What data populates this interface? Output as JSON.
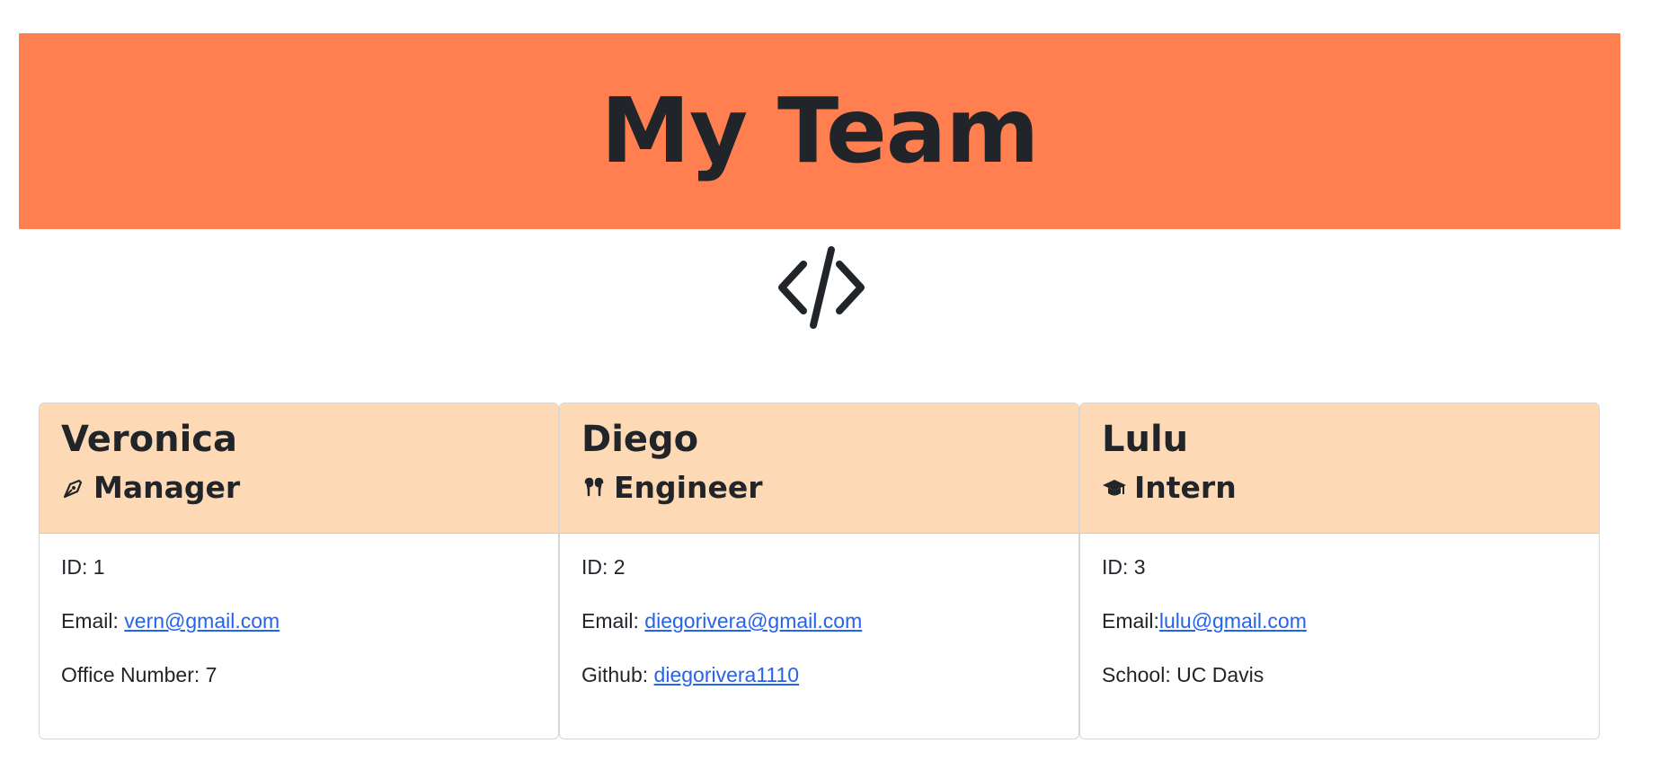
{
  "header": {
    "title": "My Team"
  },
  "icons": {
    "logo": "code-icon",
    "manager": "pen-nib-icon",
    "engineer": "earbuds-icon",
    "intern": "graduation-cap-icon"
  },
  "colors": {
    "banner": "#ff7f50",
    "card_header": "#fdd9b5",
    "link": "#2563eb"
  },
  "cards": [
    {
      "name": "Veronica",
      "role": "Manager",
      "id_label": "ID: 1",
      "email_label": "Email: ",
      "email": "vern@gmail.com",
      "extra_label": "Office Number: 7"
    },
    {
      "name": "Diego",
      "role": "Engineer",
      "id_label": "ID: 2",
      "email_label": "Email: ",
      "email": "diegorivera@gmail.com",
      "extra_label": "Github: ",
      "extra_link": "diegorivera1110"
    },
    {
      "name": "Lulu",
      "role": "Intern",
      "id_label": "ID: 3",
      "email_label": "Email:",
      "email": "lulu@gmail.com",
      "extra_label": "School: UC Davis"
    }
  ]
}
